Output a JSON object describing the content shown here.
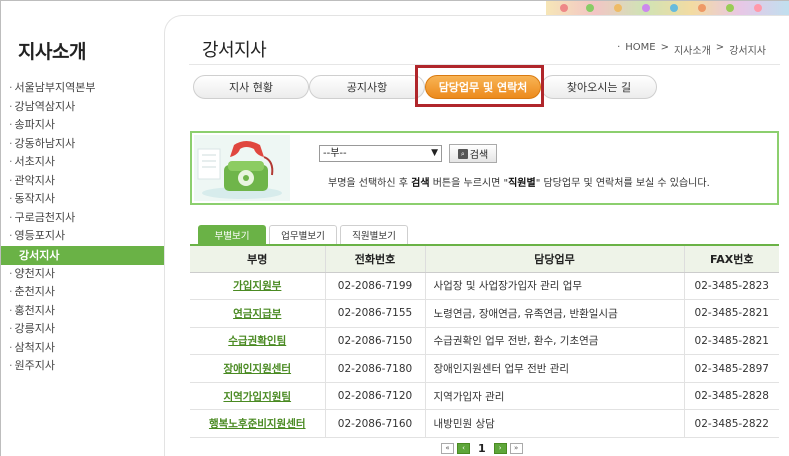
{
  "sidebar": {
    "title": "지사소개",
    "items": [
      "서울남부지역본부",
      "강남역삼지사",
      "송파지사",
      "강동하남지사",
      "서초지사",
      "관악지사",
      "동작지사",
      "구로금천지사",
      "영등포지사",
      "강서지사",
      "양천지사",
      "춘천지사",
      "홍천지사",
      "강릉지사",
      "삼척지사",
      "원주지사"
    ],
    "active_index": 9
  },
  "header": {
    "title": "강서지사",
    "breadcrumb": [
      "HOME",
      "지사소개",
      "강서지사"
    ],
    "breadcrumb_sep": ">",
    "breadcrumb_prefix": "·"
  },
  "tabs": [
    {
      "label": "지사 현황"
    },
    {
      "label": "공지사항"
    },
    {
      "label": "담당업무 및 연락처"
    },
    {
      "label": "찾아오시는 길"
    }
  ],
  "search": {
    "select_value": "--부--",
    "button_label": "검색",
    "help_parts": [
      "부명을 선택하신 후 ",
      "검색",
      " 버튼을 누르시면 \"",
      "직원별",
      "\" 담당업무 및 연락처를 보실 수 있습니다."
    ]
  },
  "subtabs": [
    "부별보기",
    "업무별보기",
    "직원별보기"
  ],
  "table": {
    "headers": [
      "부명",
      "전화번호",
      "담당업무",
      "FAX번호"
    ],
    "rows": [
      {
        "dept": "가입지원부",
        "tel": "02-2086-7199",
        "duty": "사업장 및 사업장가입자 관리 업무",
        "fax": "02-3485-2823"
      },
      {
        "dept": "연금지급부",
        "tel": "02-2086-7155",
        "duty": "노령연금, 장애연금, 유족연금, 반환일시금",
        "fax": "02-3485-2821"
      },
      {
        "dept": "수급권확인팀",
        "tel": "02-2086-7150",
        "duty": "수급권확인 업무 전반, 환수, 기초연금",
        "fax": "02-3485-2821"
      },
      {
        "dept": "장애인지원센터",
        "tel": "02-2086-7180",
        "duty": "장애인지원센터 업무 전반 관리",
        "fax": "02-3485-2897"
      },
      {
        "dept": "지역가입지원팀",
        "tel": "02-2086-7120",
        "duty": "지역가입자 관리",
        "fax": "02-3485-2828"
      },
      {
        "dept": "행복노후준비지원센터",
        "tel": "02-2086-7160",
        "duty": "내방민원 상담",
        "fax": "02-3485-2822"
      }
    ]
  },
  "pager": {
    "current": "1",
    "first": "«",
    "prev": "‹",
    "next": "›",
    "last": "»"
  },
  "colors": {
    "accent_green": "#6ab246",
    "active_tab_orange": "#ec8a1c",
    "highlight_red": "#b0262b"
  }
}
